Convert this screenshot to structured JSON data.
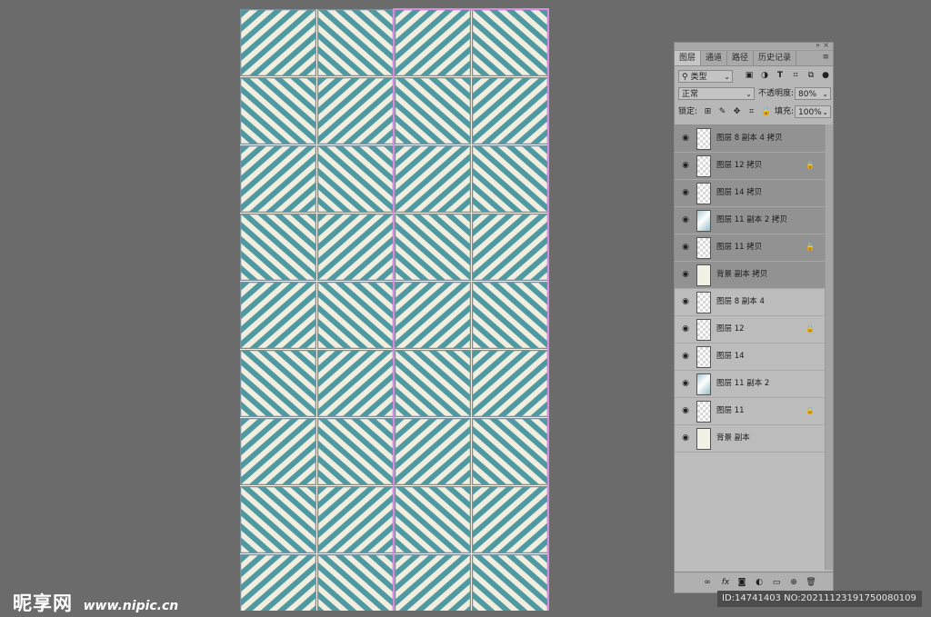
{
  "panel": {
    "tabs": [
      {
        "label": "图层",
        "active": true
      },
      {
        "label": "通道",
        "active": false
      },
      {
        "label": "路径",
        "active": false
      },
      {
        "label": "历史记录",
        "active": false
      }
    ],
    "filter_label": "类型",
    "blend_mode": "正常",
    "opacity_label": "不透明度:",
    "opacity_value": "80%",
    "lock_label": "锁定:",
    "fill_label": "填充:",
    "fill_value": "100%",
    "layers": [
      {
        "name": "图层 8 副本 4 拷贝",
        "selected": true,
        "locked": false,
        "thumb": "checker"
      },
      {
        "name": "图层 12 拷贝",
        "selected": true,
        "locked": true,
        "thumb": "checker"
      },
      {
        "name": "图层 14 拷贝",
        "selected": true,
        "locked": false,
        "thumb": "checker"
      },
      {
        "name": "图层 11 副本 2 拷贝",
        "selected": true,
        "locked": false,
        "thumb": "teal"
      },
      {
        "name": "图层 11 拷贝",
        "selected": true,
        "locked": true,
        "thumb": "checker"
      },
      {
        "name": "背景 副本 拷贝",
        "selected": true,
        "locked": false,
        "thumb": "bg"
      },
      {
        "name": "图层 8 副本 4",
        "selected": false,
        "locked": false,
        "thumb": "checker"
      },
      {
        "name": "图层 12",
        "selected": false,
        "locked": true,
        "thumb": "checker"
      },
      {
        "name": "图层 14",
        "selected": false,
        "locked": false,
        "thumb": "checker"
      },
      {
        "name": "图层 11 副本 2",
        "selected": false,
        "locked": false,
        "thumb": "teal"
      },
      {
        "name": "图层 11",
        "selected": false,
        "locked": true,
        "thumb": "checker"
      },
      {
        "name": "背景 副本",
        "selected": false,
        "locked": false,
        "thumb": "bg"
      }
    ],
    "icons": [
      "image-filter-icon",
      "adjustment-filter-icon",
      "type-filter-icon",
      "shape-filter-icon",
      "smart-object-filter-icon",
      "filter-toggle-icon"
    ]
  },
  "canvas": {
    "pattern_colors": {
      "teal": "#4f9aa2",
      "cream": "#f1eee0",
      "grout": "#7c8f99"
    },
    "guide_color": "#d58be0"
  },
  "watermark": {
    "brand": "昵享网",
    "url": "www.nipic.cn"
  },
  "id_text": "ID:14741403 NO:20211123191750080109"
}
